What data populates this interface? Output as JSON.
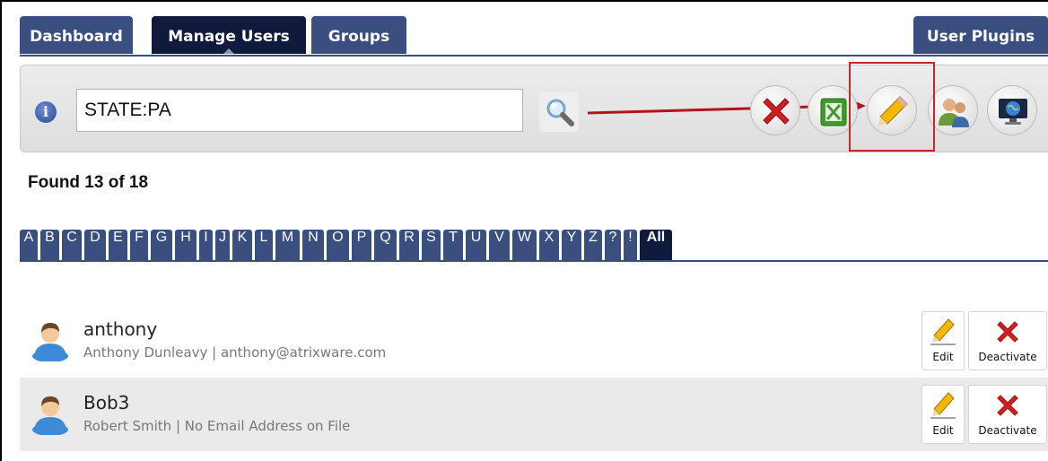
{
  "tabs": [
    {
      "label": "Dashboard",
      "active": false
    },
    {
      "label": "Manage Users",
      "active": true
    },
    {
      "label": "Groups",
      "active": false
    },
    {
      "label": "User Plugins",
      "active": false
    }
  ],
  "search": {
    "value": "STATE:PA"
  },
  "toolbar_icons": [
    "delete-x-icon",
    "spreadsheet-export-icon",
    "pencil-edit-icon",
    "users-group-icon",
    "globe-monitor-icon"
  ],
  "found_text": "Found 13 of 18",
  "letters": [
    "A",
    "B",
    "C",
    "D",
    "E",
    "F",
    "G",
    "H",
    "I",
    "J",
    "K",
    "L",
    "M",
    "N",
    "O",
    "P",
    "Q",
    "R",
    "S",
    "T",
    "U",
    "V",
    "W",
    "X",
    "Y",
    "Z",
    "?",
    "!",
    "All"
  ],
  "active_letter": "All",
  "users": [
    {
      "username": "anthony",
      "details": "Anthony Dunleavy | anthony@atrixware.com",
      "edit_label": "Edit",
      "deactivate_label": "Deactivate"
    },
    {
      "username": "Bob3",
      "details": "Robert Smith | No Email Address on File",
      "edit_label": "Edit",
      "deactivate_label": "Deactivate"
    }
  ],
  "colors": {
    "tab": "#3b4e80",
    "tab_active": "#0f1a3d",
    "highlight": "#c3272b"
  }
}
